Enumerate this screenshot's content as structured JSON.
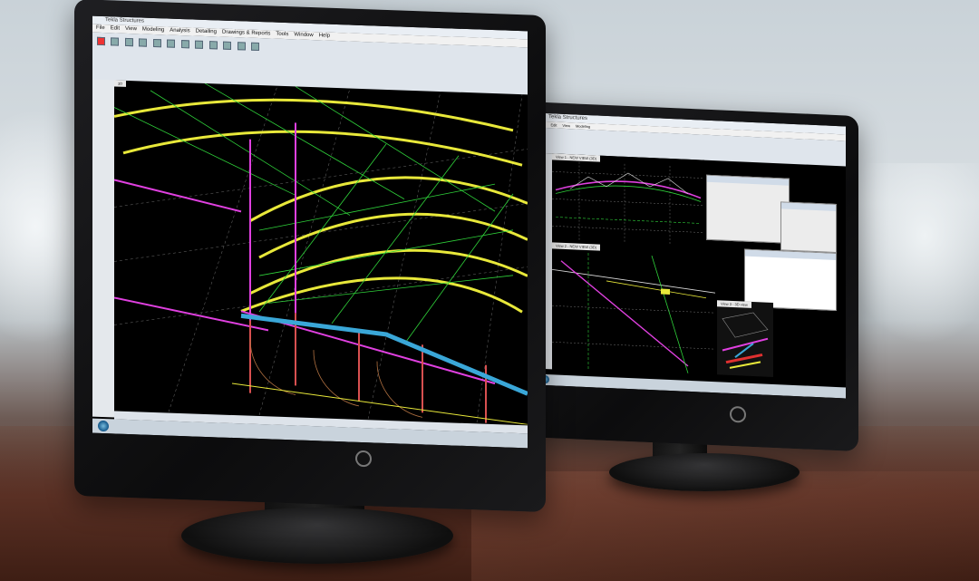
{
  "monitor_left": {
    "window_title": "Tekla Structures",
    "menu": [
      "File",
      "Edit",
      "View",
      "Modeling",
      "Analysis",
      "Detailing",
      "Drawings & Reports",
      "Tools",
      "Window",
      "Help"
    ],
    "view_label": "3D"
  },
  "monitor_right": {
    "window_title": "Tekla Structures",
    "view_labels": [
      "View 1 - NEW VIEW (3D)",
      "View 2 - NEW VIEW (3D)",
      "View 3 - 3D view"
    ]
  },
  "colors": {
    "steel_members": "#e8e83a",
    "bracing": "#2fd23a",
    "pink_members": "#e040e0",
    "concrete_beam": "#3aa7d8",
    "grid": "#8a8a8a",
    "background": "#000000"
  },
  "icons": {
    "start": "windows-start-icon",
    "monitor_logo": "power-logo-icon"
  }
}
